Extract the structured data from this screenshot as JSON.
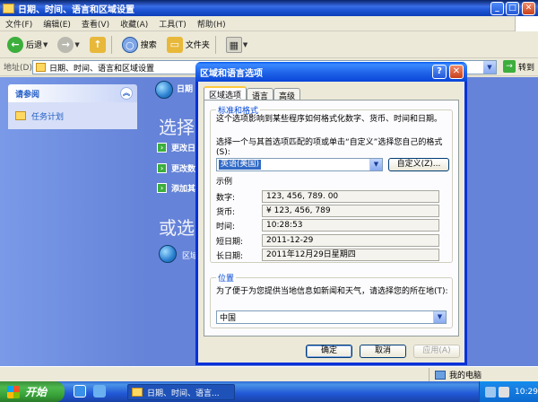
{
  "window": {
    "title": "日期、时间、语言和区域设置",
    "menu": [
      "文件(F)",
      "编辑(E)",
      "查看(V)",
      "收藏(A)",
      "工具(T)",
      "帮助(H)"
    ],
    "toolbar": {
      "back": "后退",
      "search": "搜索",
      "folders": "文件夹"
    },
    "address_label": "地址(D)",
    "address_value": "日期、时间、语言和区域设置",
    "go": "转到"
  },
  "leftpane": {
    "header": "请参阅",
    "items": [
      "任务计划"
    ]
  },
  "main": {
    "category_title": "日期",
    "pick_task": "选择",
    "tasks": [
      "更改日",
      "更改数",
      "添加其"
    ],
    "or_pick": "或选",
    "icon_label": "区域"
  },
  "statusbar": {
    "computer": "我的电脑"
  },
  "taskbar": {
    "start": "开始",
    "task": "日期、时间、语言...",
    "clock": "10:29"
  },
  "dialog": {
    "title": "区域和语言选项",
    "tabs": [
      "区域选项",
      "语言",
      "高级"
    ],
    "standards_group": "标准和格式",
    "standards_desc": "这个选项影响到某些程序如何格式化数字、货币、时间和日期。",
    "select_desc": "选择一个与其首选项匹配的项或单击“自定义”选择您自己的格式(S):",
    "format_value": "英语(美国)",
    "customize": "自定义(Z)...",
    "samples_title": "示例",
    "samples": [
      {
        "label": "数字:",
        "value": "123, 456, 789. 00"
      },
      {
        "label": "货币:",
        "value": "¥ 123, 456, 789"
      },
      {
        "label": "时间:",
        "value": "10:28:53"
      },
      {
        "label": "短日期:",
        "value": "2011-12-29"
      },
      {
        "label": "长日期:",
        "value": "2011年12月29日星期四"
      }
    ],
    "location_group": "位置",
    "location_desc": "为了便于为您提供当地信息如新闻和天气，请选择您的所在地(T):",
    "location_value": "中国",
    "ok": "确定",
    "cancel": "取消",
    "apply": "应用(A)"
  }
}
